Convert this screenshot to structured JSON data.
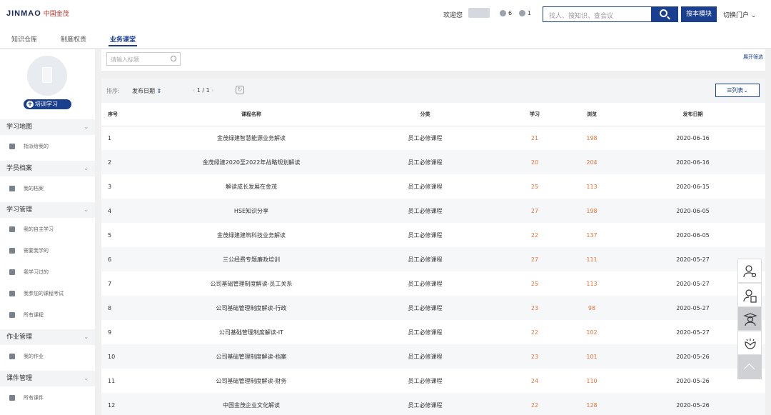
{
  "header": {
    "logo_text": "JINMAO",
    "logo_cn": "中国金茂",
    "welcome": "欢迎您",
    "count_a": "6",
    "count_b": "1",
    "search_placeholder": "找人、搜知识、查会议",
    "module_button": "搜本模块",
    "portal": "切换门户",
    "portal_caret": "⌄"
  },
  "nav": {
    "tabs": [
      {
        "label": "知识仓库"
      },
      {
        "label": "制度权责"
      },
      {
        "label": "业务课堂"
      }
    ]
  },
  "sidebar": {
    "train_button": "培训学习",
    "groups": [
      {
        "label": "学习地图",
        "items": [
          {
            "label": "指派给我的"
          }
        ]
      },
      {
        "label": "学员档案",
        "items": [
          {
            "label": "我的档案"
          }
        ]
      },
      {
        "label": "学习管理",
        "items": [
          {
            "label": "我的自主学习"
          },
          {
            "label": "需要我学的"
          },
          {
            "label": "我学习过的"
          },
          {
            "label": "我参加的课程考试"
          },
          {
            "label": "所有课程"
          }
        ]
      },
      {
        "label": "作业管理",
        "items": [
          {
            "label": "我的作业"
          }
        ]
      },
      {
        "label": "课件管理",
        "items": [
          {
            "label": "所有课件"
          }
        ]
      }
    ]
  },
  "filter": {
    "title_placeholder": "请输入标题",
    "expand": "展开筛选"
  },
  "toolbar": {
    "sort_label": "排序:",
    "sort_value": "发布日期",
    "sort_arrow": "⇕",
    "page_prev": "‹",
    "page": "1 / 1",
    "page_next": "›",
    "refresh": "↻",
    "view_button": "☰列表⌄"
  },
  "table": {
    "headers": [
      "序号",
      "课程名称",
      "分类",
      "学习",
      "浏览",
      "发布日期"
    ],
    "rows": [
      {
        "no": "1",
        "name": "金茂绿建智慧能源业务解读",
        "category": "员工必修课程",
        "study": "21",
        "views": "198",
        "date": "2020-06-16"
      },
      {
        "no": "2",
        "name": "金茂绿建2020至2022年战略规划解读",
        "category": "员工必修课程",
        "study": "20",
        "views": "204",
        "date": "2020-06-16"
      },
      {
        "no": "3",
        "name": "解读成长发展在金茂",
        "category": "员工必修课程",
        "study": "25",
        "views": "113",
        "date": "2020-06-15"
      },
      {
        "no": "4",
        "name": "HSE知识分享",
        "category": "员工必修课程",
        "study": "27",
        "views": "198",
        "date": "2020-06-05"
      },
      {
        "no": "5",
        "name": "金茂绿建建筑科技业务解读",
        "category": "员工必修课程",
        "study": "22",
        "views": "137",
        "date": "2020-06-05"
      },
      {
        "no": "6",
        "name": "三公经费专题廉政培训",
        "category": "员工必修课程",
        "study": "27",
        "views": "111",
        "date": "2020-05-27"
      },
      {
        "no": "7",
        "name": "公司基础管理制度解读-员工关系",
        "category": "员工必修课程",
        "study": "25",
        "views": "113",
        "date": "2020-05-27"
      },
      {
        "no": "8",
        "name": "公司基础管理制度解读-行政",
        "category": "员工必修课程",
        "study": "23",
        "views": "98",
        "date": "2020-05-27"
      },
      {
        "no": "9",
        "name": "公司基础管理制度解读-IT",
        "category": "员工必修课程",
        "study": "22",
        "views": "102",
        "date": "2020-05-27"
      },
      {
        "no": "10",
        "name": "公司基础管理制度解读-档案",
        "category": "员工必修课程",
        "study": "23",
        "views": "101",
        "date": "2020-05-26"
      },
      {
        "no": "11",
        "name": "公司基础管理制度解读-财务",
        "category": "员工必修课程",
        "study": "24",
        "views": "110",
        "date": "2020-05-26"
      },
      {
        "no": "12",
        "name": "中国金茂企业文化解读",
        "category": "员工必修课程",
        "study": "22",
        "views": "128",
        "date": "2020-05-26"
      }
    ]
  },
  "float_icons": [
    "user-settings-icon",
    "user-document-icon",
    "graduate-icon",
    "lotus-icon",
    "back-to-top-icon"
  ],
  "colors": {
    "brand": "#1a3f8f",
    "number": "#e8733a",
    "logo_red": "#c0392b"
  }
}
